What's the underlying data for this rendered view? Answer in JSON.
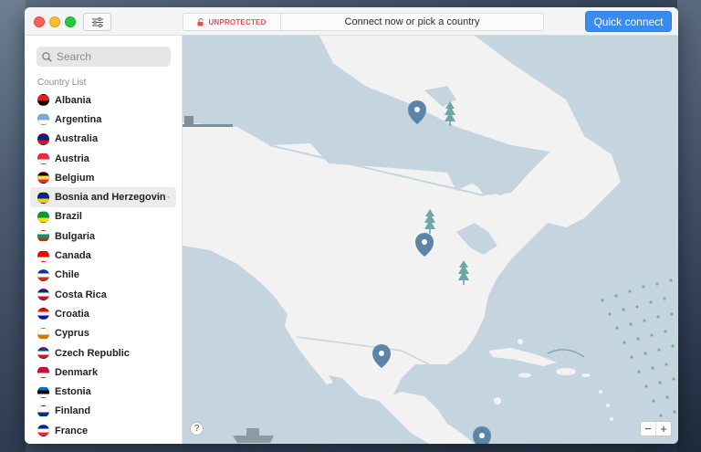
{
  "toolbar": {
    "status_label": "UNPROTECTED",
    "status_message": "Connect now or pick a country",
    "quick_connect_label": "Quick connect"
  },
  "sidebar": {
    "search_placeholder": "Search",
    "list_title": "Country List",
    "countries": [
      {
        "name": "Albania",
        "flag_colors": [
          "#e41e20",
          "#000000"
        ]
      },
      {
        "name": "Argentina",
        "flag_colors": [
          "#74acdf",
          "#ffffff"
        ]
      },
      {
        "name": "Australia",
        "flag_colors": [
          "#00247d",
          "#cf142b"
        ]
      },
      {
        "name": "Austria",
        "flag_colors": [
          "#ed2939",
          "#ffffff"
        ]
      },
      {
        "name": "Belgium",
        "flag_colors": [
          "#000000",
          "#fae042",
          "#ed2939"
        ]
      },
      {
        "name": "Bosnia and Herzegovin",
        "flag_colors": [
          "#002395",
          "#fecb00"
        ]
      },
      {
        "name": "Brazil",
        "flag_colors": [
          "#009c3b",
          "#ffdf00"
        ]
      },
      {
        "name": "Bulgaria",
        "flag_colors": [
          "#ffffff",
          "#00966e",
          "#d62612"
        ]
      },
      {
        "name": "Canada",
        "flag_colors": [
          "#ff0000",
          "#ffffff"
        ]
      },
      {
        "name": "Chile",
        "flag_colors": [
          "#0039a6",
          "#ffffff",
          "#d52b1e"
        ]
      },
      {
        "name": "Costa Rica",
        "flag_colors": [
          "#002b7f",
          "#ffffff",
          "#ce1126"
        ]
      },
      {
        "name": "Croatia",
        "flag_colors": [
          "#ff0000",
          "#ffffff",
          "#171796"
        ]
      },
      {
        "name": "Cyprus",
        "flag_colors": [
          "#ffffff",
          "#d57800"
        ]
      },
      {
        "name": "Czech Republic",
        "flag_colors": [
          "#11457e",
          "#ffffff",
          "#d7141a"
        ]
      },
      {
        "name": "Denmark",
        "flag_colors": [
          "#c8102e",
          "#ffffff"
        ]
      },
      {
        "name": "Estonia",
        "flag_colors": [
          "#0072ce",
          "#000000",
          "#ffffff"
        ]
      },
      {
        "name": "Finland",
        "flag_colors": [
          "#ffffff",
          "#003580"
        ]
      },
      {
        "name": "France",
        "flag_colors": [
          "#002395",
          "#ffffff",
          "#ed2939"
        ]
      }
    ],
    "selected_country": "Bosnia and Herzegovin",
    "more_label": "···"
  },
  "map": {
    "help_label": "?",
    "zoom_out_label": "−",
    "zoom_in_label": "+",
    "ocean_color": "#c5d5e0",
    "land_color": "#f2f2f2",
    "pin_color": "#5a85a9"
  },
  "colors": {
    "accent": "#3a8bf0",
    "status_red": "#e0524a"
  }
}
